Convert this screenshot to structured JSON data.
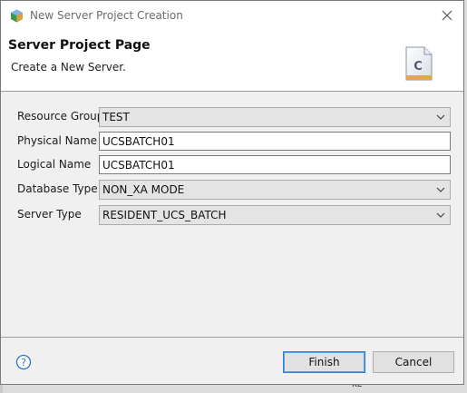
{
  "window": {
    "title": "New Server Project Creation",
    "icons": {
      "app": "app-logo-icon",
      "close": "close-icon"
    }
  },
  "header": {
    "title": "Server Project Page",
    "description": "Create a New Server.",
    "icon": "wizard-class-file-icon",
    "icon_letter": "C"
  },
  "form": {
    "resource_group": {
      "label": "Resource Group",
      "value": "TEST"
    },
    "physical_name": {
      "label": "Physical Name",
      "value": "UCSBATCH01"
    },
    "logical_name": {
      "label": "Logical Name",
      "value": "UCSBATCH01"
    },
    "database_type": {
      "label": "Database Type",
      "value": "NON_XA MODE"
    },
    "server_type": {
      "label": "Server Type",
      "value": "RESIDENT_UCS_BATCH"
    }
  },
  "footer": {
    "help_icon": "help-icon",
    "finish_label": "Finish",
    "cancel_label": "Cancel"
  },
  "background": {
    "bottom_fragment": "KE"
  },
  "colors": {
    "dialog_bg": "#f0f0f0",
    "header_bg": "#ffffff",
    "focus_border": "#2e7fd6",
    "help_icon": "#2b73c4"
  }
}
